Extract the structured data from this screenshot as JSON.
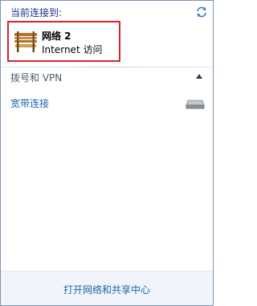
{
  "header": {
    "title": "当前连接到:",
    "refresh_icon": "refresh-arrows-icon"
  },
  "current_connection": {
    "name": "网络  2",
    "status": "Internet 访问",
    "icon": "park-bench-network-icon",
    "highlight_color": "#d8242c"
  },
  "dialup_section": {
    "title": "拨号和 VPN",
    "toggle_icon": "collapse-up-icon",
    "items": [
      {
        "label": "宽带连接",
        "icon": "modem-device-icon"
      }
    ]
  },
  "footer": {
    "link": "打开网络和共享中心"
  },
  "colors": {
    "heading": "#1e3287",
    "link": "#1a64a8",
    "border": "#7a95b5",
    "footer_bg": "#f1f5fb"
  }
}
